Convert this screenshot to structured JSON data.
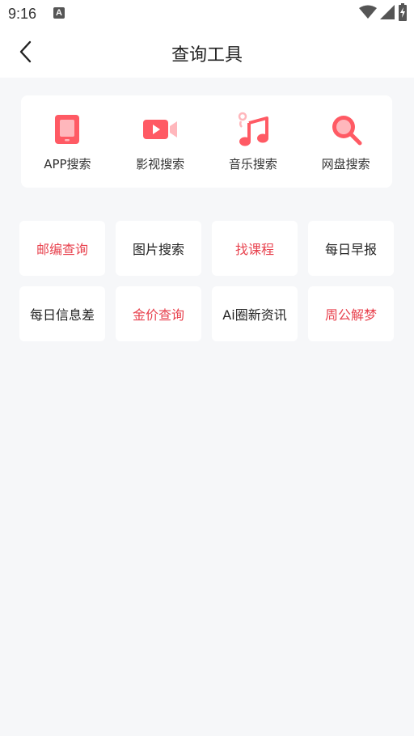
{
  "status": {
    "time": "9:16",
    "notification_icon": "a-icon",
    "icons": [
      "wifi-icon",
      "signal-icon",
      "battery-icon"
    ]
  },
  "header": {
    "title": "查询工具",
    "back_icon": "chevron-left-icon"
  },
  "colors": {
    "accent": "#ff5a64",
    "red_text": "#e8424e",
    "dark_text": "#222222",
    "background": "#f6f7f9"
  },
  "tools": [
    {
      "label": "APP搜索",
      "icon": "phone-icon"
    },
    {
      "label": "影视搜索",
      "icon": "video-camera-icon"
    },
    {
      "label": "音乐搜索",
      "icon": "music-note-icon"
    },
    {
      "label": "网盘搜索",
      "icon": "search-icon"
    }
  ],
  "grid": [
    {
      "label": "邮编查询",
      "color": "red"
    },
    {
      "label": "图片搜索",
      "color": "dark"
    },
    {
      "label": "找课程",
      "color": "red"
    },
    {
      "label": "每日早报",
      "color": "dark"
    },
    {
      "label": "每日信息差",
      "color": "dark"
    },
    {
      "label": "金价查询",
      "color": "red"
    },
    {
      "label": "Ai圈新资讯",
      "color": "dark"
    },
    {
      "label": "周公解梦",
      "color": "red"
    }
  ]
}
